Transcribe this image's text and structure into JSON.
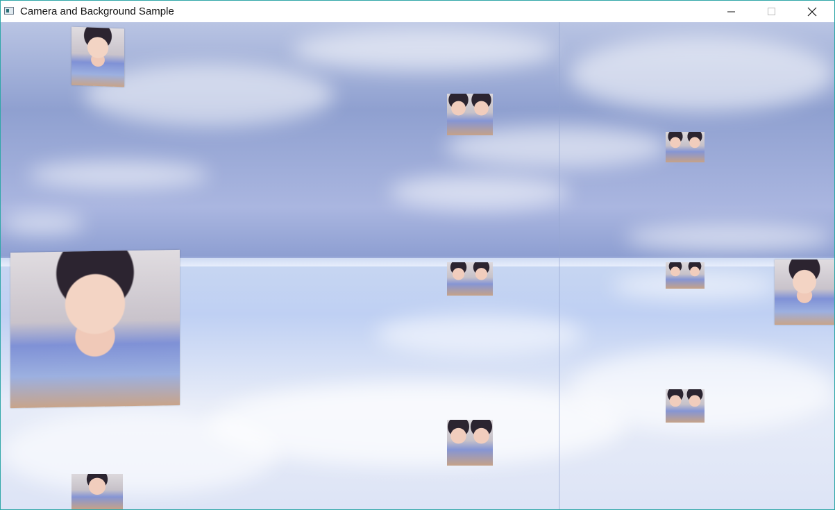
{
  "window": {
    "title": "Camera and Background Sample",
    "icon": "app-window-icon",
    "controls": {
      "minimize": "—",
      "maximize": "□",
      "close": "✕"
    }
  },
  "scene": {
    "background": "sky-skybox",
    "accent_colors": {
      "sky_top": "#b9c4e3",
      "sky_mid": "#8fa0d0",
      "horizon": "#cfdbf3",
      "lower": "#e7ecf8",
      "border": "#2fa7a8"
    }
  }
}
